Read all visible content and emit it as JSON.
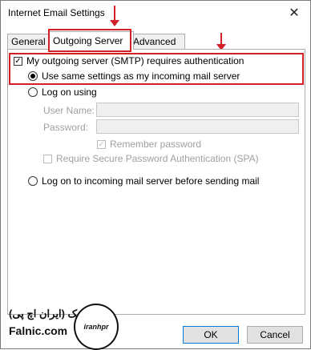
{
  "window": {
    "title": "Internet Email Settings",
    "close_glyph": "✕"
  },
  "tabs": [
    {
      "label": "General",
      "active": false
    },
    {
      "label": "Outgoing Server",
      "active": true
    },
    {
      "label": "Advanced",
      "active": false
    }
  ],
  "outgoing": {
    "requires_auth": {
      "label": "My outgoing server (SMTP) requires authentication",
      "checked": true
    },
    "use_same": {
      "label": "Use same settings as my incoming mail server",
      "selected": true
    },
    "log_on_using": {
      "label": "Log on using",
      "selected": false
    },
    "user_name_label": "User Name:",
    "user_name_value": "",
    "password_label": "Password:",
    "password_value": "",
    "remember_password": {
      "label": "Remember password",
      "checked": true
    },
    "require_spa": {
      "label": "Require Secure Password Authentication (SPA)",
      "checked": false
    },
    "log_on_incoming": {
      "label": "Log on to incoming mail server before sending mail",
      "selected": false
    }
  },
  "buttons": {
    "ok": "OK",
    "cancel": "Cancel"
  },
  "branding": {
    "persian_text": "فالنیک (ایران اچ پی)",
    "english_text": "Falnic.com",
    "badge_text": "iranhpr"
  },
  "colors": {
    "highlight": "#d32027",
    "ok_border": "#0078d7"
  }
}
